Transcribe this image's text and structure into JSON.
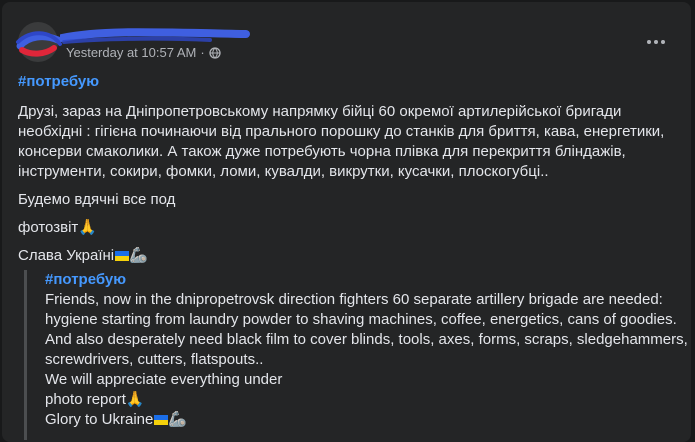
{
  "post": {
    "timestamp": "Yesterday at 10:57 AM",
    "separator": "·",
    "privacy_icon": "globe-icon",
    "more_icon": "more-options-icon",
    "original": {
      "hashtag": "#потребую",
      "paragraph_1": "Друзі, зараз на Дніпропетровському  напрямку бійці 60 окремої артилерійської бригади необхідні : гігієна починаючи від прального порошку до станків для бриття, кава, енергетики, консерви смаколики. А також дуже потребують  чорна плівка для перекриття бліндажів, інструменти, сокири, фомки, ломи, кувалди, викрутки, кусачки, плоскогубці..",
      "paragraph_2": "Будемо вдячні все под",
      "paragraph_3": "фотозвіт",
      "paragraph_4": "Слава Україні"
    },
    "translation": {
      "hashtag": "#потребую",
      "line_1": "Friends, now in the dnipropetrovsk direction fighters 60 separate artillery brigade are needed: hygiene starting from laundry powder to shaving machines, coffee, energetics, cans of goodies. And also desperately need black film to cover blinds, tools, axes, forms, scraps, sledgehammers, screwdrivers, cutters, flatspouts..",
      "line_2": "We will appreciate everything under",
      "line_3": "photo report",
      "line_4": "Glory to Ukraine"
    },
    "emoji": {
      "pray": "🙏",
      "arm": "🦾"
    },
    "colors": {
      "background": "#242526",
      "text": "#e4e6eb",
      "secondary_text": "#b0b3b8",
      "hashtag": "#4599ff",
      "flag_blue": "#1b6ee8",
      "flag_yellow": "#f5d10b"
    }
  }
}
